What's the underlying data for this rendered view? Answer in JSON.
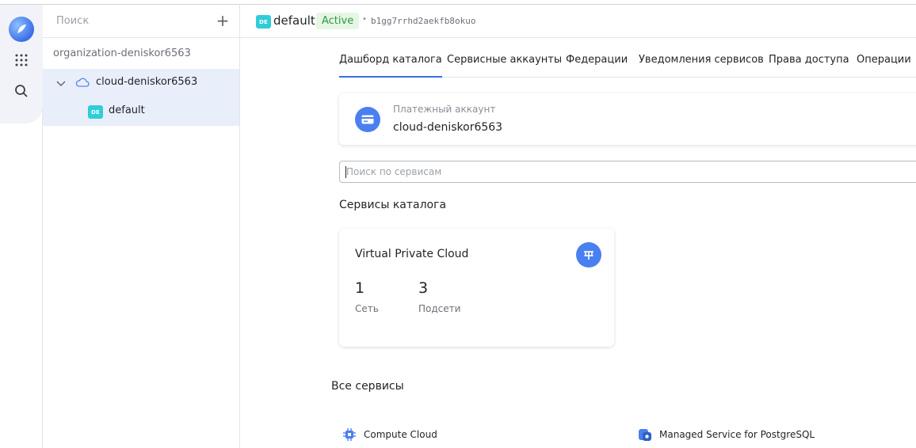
{
  "sidebar": {
    "search_placeholder": "Поиск",
    "organization": "organization-deniskor6563",
    "cloud": "cloud-deniskor6563",
    "folder": {
      "badge": "DE",
      "label": "default"
    }
  },
  "header": {
    "badge": "DE",
    "title": "default",
    "status": "Active",
    "separator": "•",
    "id": "b1gg7rrhd2aekfb8okuo"
  },
  "tabs": [
    {
      "label": "Дашборд каталога"
    },
    {
      "label": "Сервисные аккаунты"
    },
    {
      "label": "Федерации"
    },
    {
      "label": "Уведомления сервисов"
    },
    {
      "label": "Права доступа"
    },
    {
      "label": "Операции"
    }
  ],
  "billing": {
    "label": "Платежный аккаунт",
    "value": "cloud-deniskor6563"
  },
  "service_search": {
    "placeholder": "Поиск по сервисам"
  },
  "catalog_services": {
    "title": "Сервисы каталога",
    "vpc": {
      "title": "Virtual Private Cloud",
      "stats": [
        {
          "value": "1",
          "label": "Сеть"
        },
        {
          "value": "3",
          "label": "Подсети"
        }
      ]
    }
  },
  "all_services": {
    "title": "Все сервисы",
    "items": [
      {
        "label": "Compute Cloud"
      },
      {
        "label": "Managed Service for PostgreSQL"
      }
    ]
  },
  "colors": {
    "accent": "#3a6fe0",
    "badge": "#2fcdd8",
    "status_bg": "#e6f6e5",
    "status_text": "#2e9a3c",
    "selected_bg": "#e9eefb"
  }
}
